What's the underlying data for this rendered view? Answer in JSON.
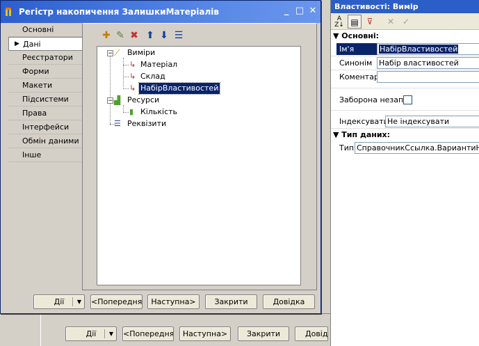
{
  "dialog": {
    "title": "Регістр накопичення ЗалишкиМатеріалів",
    "nav": [
      "Основні",
      "Дані",
      "Реєстратори",
      "Форми",
      "Макети",
      "Підсистеми",
      "Права",
      "Інтерфейси",
      "Обмін даними",
      "Інше"
    ],
    "selected_nav": "Дані",
    "tree": {
      "dimensions": "Виміри",
      "dim_items": [
        "Матеріал",
        "Склад",
        "НабірВластивостей"
      ],
      "resources": "Ресурси",
      "res_items": [
        "Кількість"
      ],
      "requisites": "Реквізити"
    },
    "buttons": {
      "actions": "Дії",
      "previous": "<Попередня",
      "next": "Наступна>",
      "close": "Закрити",
      "help": "Довідка"
    }
  },
  "background_buttons": {
    "actions": "Дії",
    "previous": "<Попередня",
    "next": "Наступна>",
    "close": "Закрити",
    "help": "Довідк"
  },
  "properties": {
    "title": "Властивості: Вимір",
    "section_main": "Основні:",
    "name_label": "Ім'я",
    "name_value": "НабірВластивостей",
    "synonym_label": "Синонім",
    "synonym_value": "Набір властивостей",
    "comment_label": "Коментар",
    "comment_value": "",
    "forbid_label": "Заборона незапо",
    "index_label": "Індексувати",
    "index_value": "Не індексувати",
    "section_type": "Тип даних:",
    "type_label": "Тип",
    "type_value": "СправочникСсылка.ВариантиНомен"
  },
  "colors": {
    "titlebar": "#2c5fcf",
    "selection": "#0a246a",
    "panel": "#d4d0c8"
  }
}
